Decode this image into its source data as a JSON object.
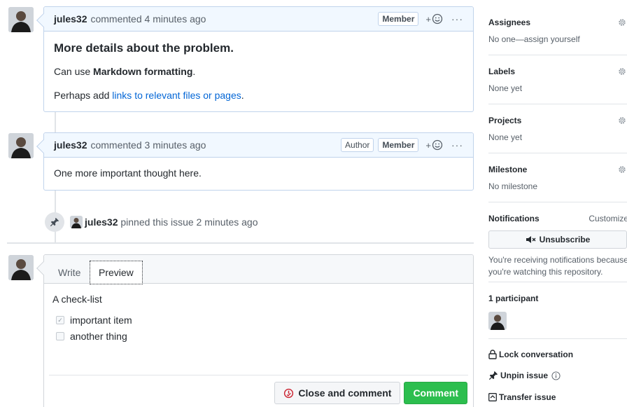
{
  "comments": [
    {
      "author": "jules32",
      "action": "commented 4 minutes ago",
      "badges": [
        "Member"
      ],
      "heading": "More details about the problem.",
      "line1_prefix": "Can use ",
      "line1_bold": "Markdown formatting",
      "line1_suffix": ".",
      "line2_prefix": "Perhaps add ",
      "line2_link": "links to relevant files or pages",
      "line2_suffix": "."
    },
    {
      "author": "jules32",
      "action": "commented 3 minutes ago",
      "badges": [
        "Author",
        "Member"
      ],
      "body": "One more important thought here."
    }
  ],
  "reaction_label": "+",
  "more_label": "···",
  "pin_event": {
    "author": "jules32",
    "text": "pinned this issue 2 minutes ago"
  },
  "editor": {
    "tab_write": "Write",
    "tab_preview": "Preview",
    "intro": "A check-list",
    "checklist": [
      {
        "label": "important item",
        "checked": true,
        "mark": "✓"
      },
      {
        "label": "another thing",
        "checked": false,
        "mark": ""
      }
    ],
    "close_button": "Close and comment",
    "comment_button": "Comment"
  },
  "sidebar": {
    "assignees": {
      "title": "Assignees",
      "value": "No one—assign yourself"
    },
    "labels": {
      "title": "Labels",
      "value": "None yet"
    },
    "projects": {
      "title": "Projects",
      "value": "None yet"
    },
    "milestone": {
      "title": "Milestone",
      "value": "No milestone"
    },
    "notifications": {
      "title": "Notifications",
      "customize": "Customize",
      "unsubscribe": "Unsubscribe",
      "note_line1": "You're receiving notifications because",
      "note_line2": "you're watching this repository."
    },
    "participants": {
      "title": "1 participant"
    },
    "lock": "Lock conversation",
    "unpin": "Unpin issue",
    "transfer": "Transfer issue"
  },
  "colors": {
    "comment_header_bg": "#f1f8ff",
    "link": "#0366d6",
    "comment_button": "#2cbe4e",
    "close_icon": "#cb2431"
  }
}
